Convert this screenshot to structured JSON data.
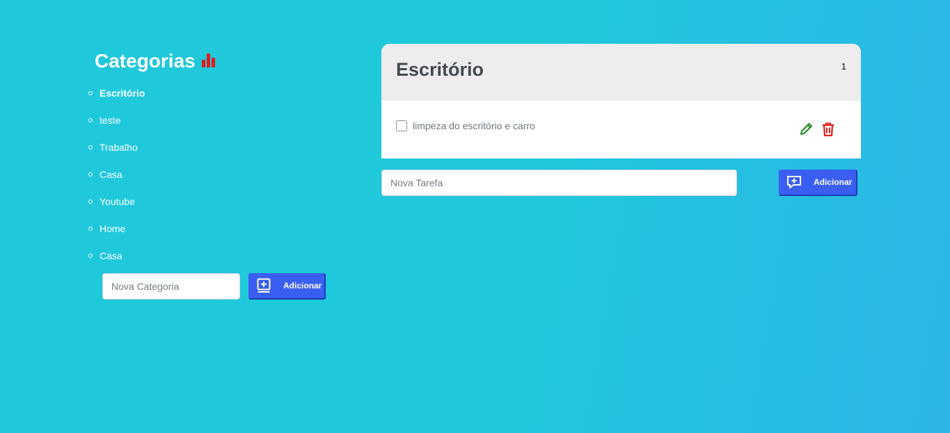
{
  "sidebar": {
    "title": "Categorias",
    "title_icon": "bar-chart-icon",
    "items": [
      {
        "label": "Escritório",
        "active": true
      },
      {
        "label": "teste",
        "active": false
      },
      {
        "label": "Trabalho",
        "active": false
      },
      {
        "label": "Casa",
        "active": false
      },
      {
        "label": "Youtube",
        "active": false
      },
      {
        "label": "Home",
        "active": false
      },
      {
        "label": "Casa",
        "active": false
      }
    ],
    "new_category_placeholder": "Nova Categoria",
    "add_button_label": "Adicionar",
    "add_button_icon": "add-box-icon"
  },
  "main": {
    "category_title": "Escritório",
    "task_count": "1",
    "tasks": [
      {
        "label": "limpeza do escritório e carro",
        "checked": false
      }
    ],
    "edit_icon": "pencil-icon",
    "delete_icon": "trash-icon",
    "new_task_placeholder": "Nova Tarefa",
    "add_button_label": "Adicionar",
    "add_button_icon": "add-comment-icon"
  },
  "colors": {
    "background": "#20c8dc",
    "button": "#3b5ef2",
    "icon_red": "#e51b1b",
    "edit_green": "#1e8a1e",
    "delete_red": "#e51b1b",
    "header_bg": "#eeecef"
  }
}
